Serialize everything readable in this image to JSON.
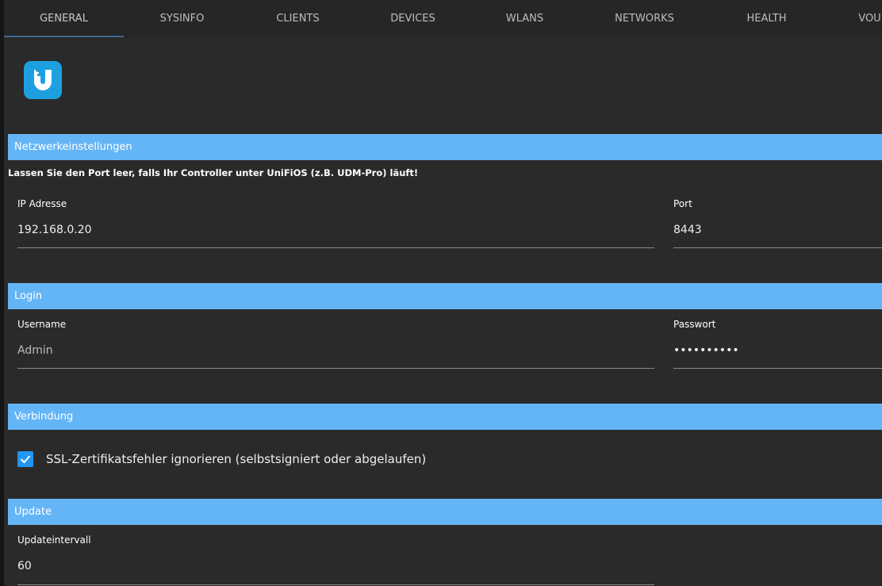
{
  "tabs": [
    "GENERAL",
    "SYSINFO",
    "CLIENTS",
    "DEVICES",
    "WLANS",
    "NETWORKS",
    "HEALTH",
    "VOU"
  ],
  "logo": {
    "icon": "unifi-logo",
    "color": "#1ea0e0"
  },
  "sections": {
    "network": {
      "title": "Netzwerkeinstellungen",
      "notice": "Lassen Sie den Port leer, falls Ihr Controller unter UniFiOS (z.B. UDM-Pro) läuft!",
      "ip_label": "IP Adresse",
      "ip_value": "192.168.0.20",
      "port_label": "Port",
      "port_value": "8443"
    },
    "login": {
      "title": "Login",
      "user_label": "Username",
      "user_value": "Admin",
      "pass_label": "Passwort",
      "pass_value": "••••••••••"
    },
    "connection": {
      "title": "Verbindung",
      "ssl_label": "SSL-Zertifikatsfehler ignorieren (selbstsigniert oder abgelaufen)",
      "ssl_checked": true
    },
    "update": {
      "title": "Update",
      "interval_label": "Updateintervall",
      "interval_value": "60"
    }
  },
  "colors": {
    "accent": "#64b5f6",
    "checkbox": "#2196f3"
  }
}
